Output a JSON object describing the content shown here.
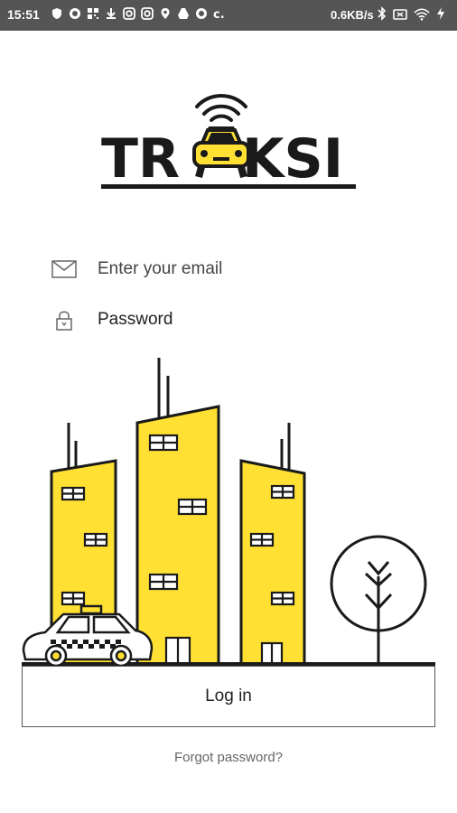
{
  "status_bar": {
    "time": "15:51",
    "network_speed": "0.6KB/s",
    "left_icons": [
      "shield-icon",
      "circle-icon",
      "qr-icon",
      "download-icon",
      "instagram-icon",
      "instagram-icon",
      "location-icon",
      "drive-icon",
      "circle-icon",
      "c-icon"
    ],
    "right_icons": [
      "bluetooth-icon",
      "sim-icon",
      "wifi-icon",
      "charging-icon"
    ]
  },
  "app": {
    "logo_text": "TRAKSI",
    "accent_color": "#FFE033",
    "ink_color": "#1a1a1a"
  },
  "login_form": {
    "email_placeholder": "Enter your email",
    "password_placeholder": "Password",
    "login_label": "Log in",
    "forgot_label": "Forgot password?"
  }
}
